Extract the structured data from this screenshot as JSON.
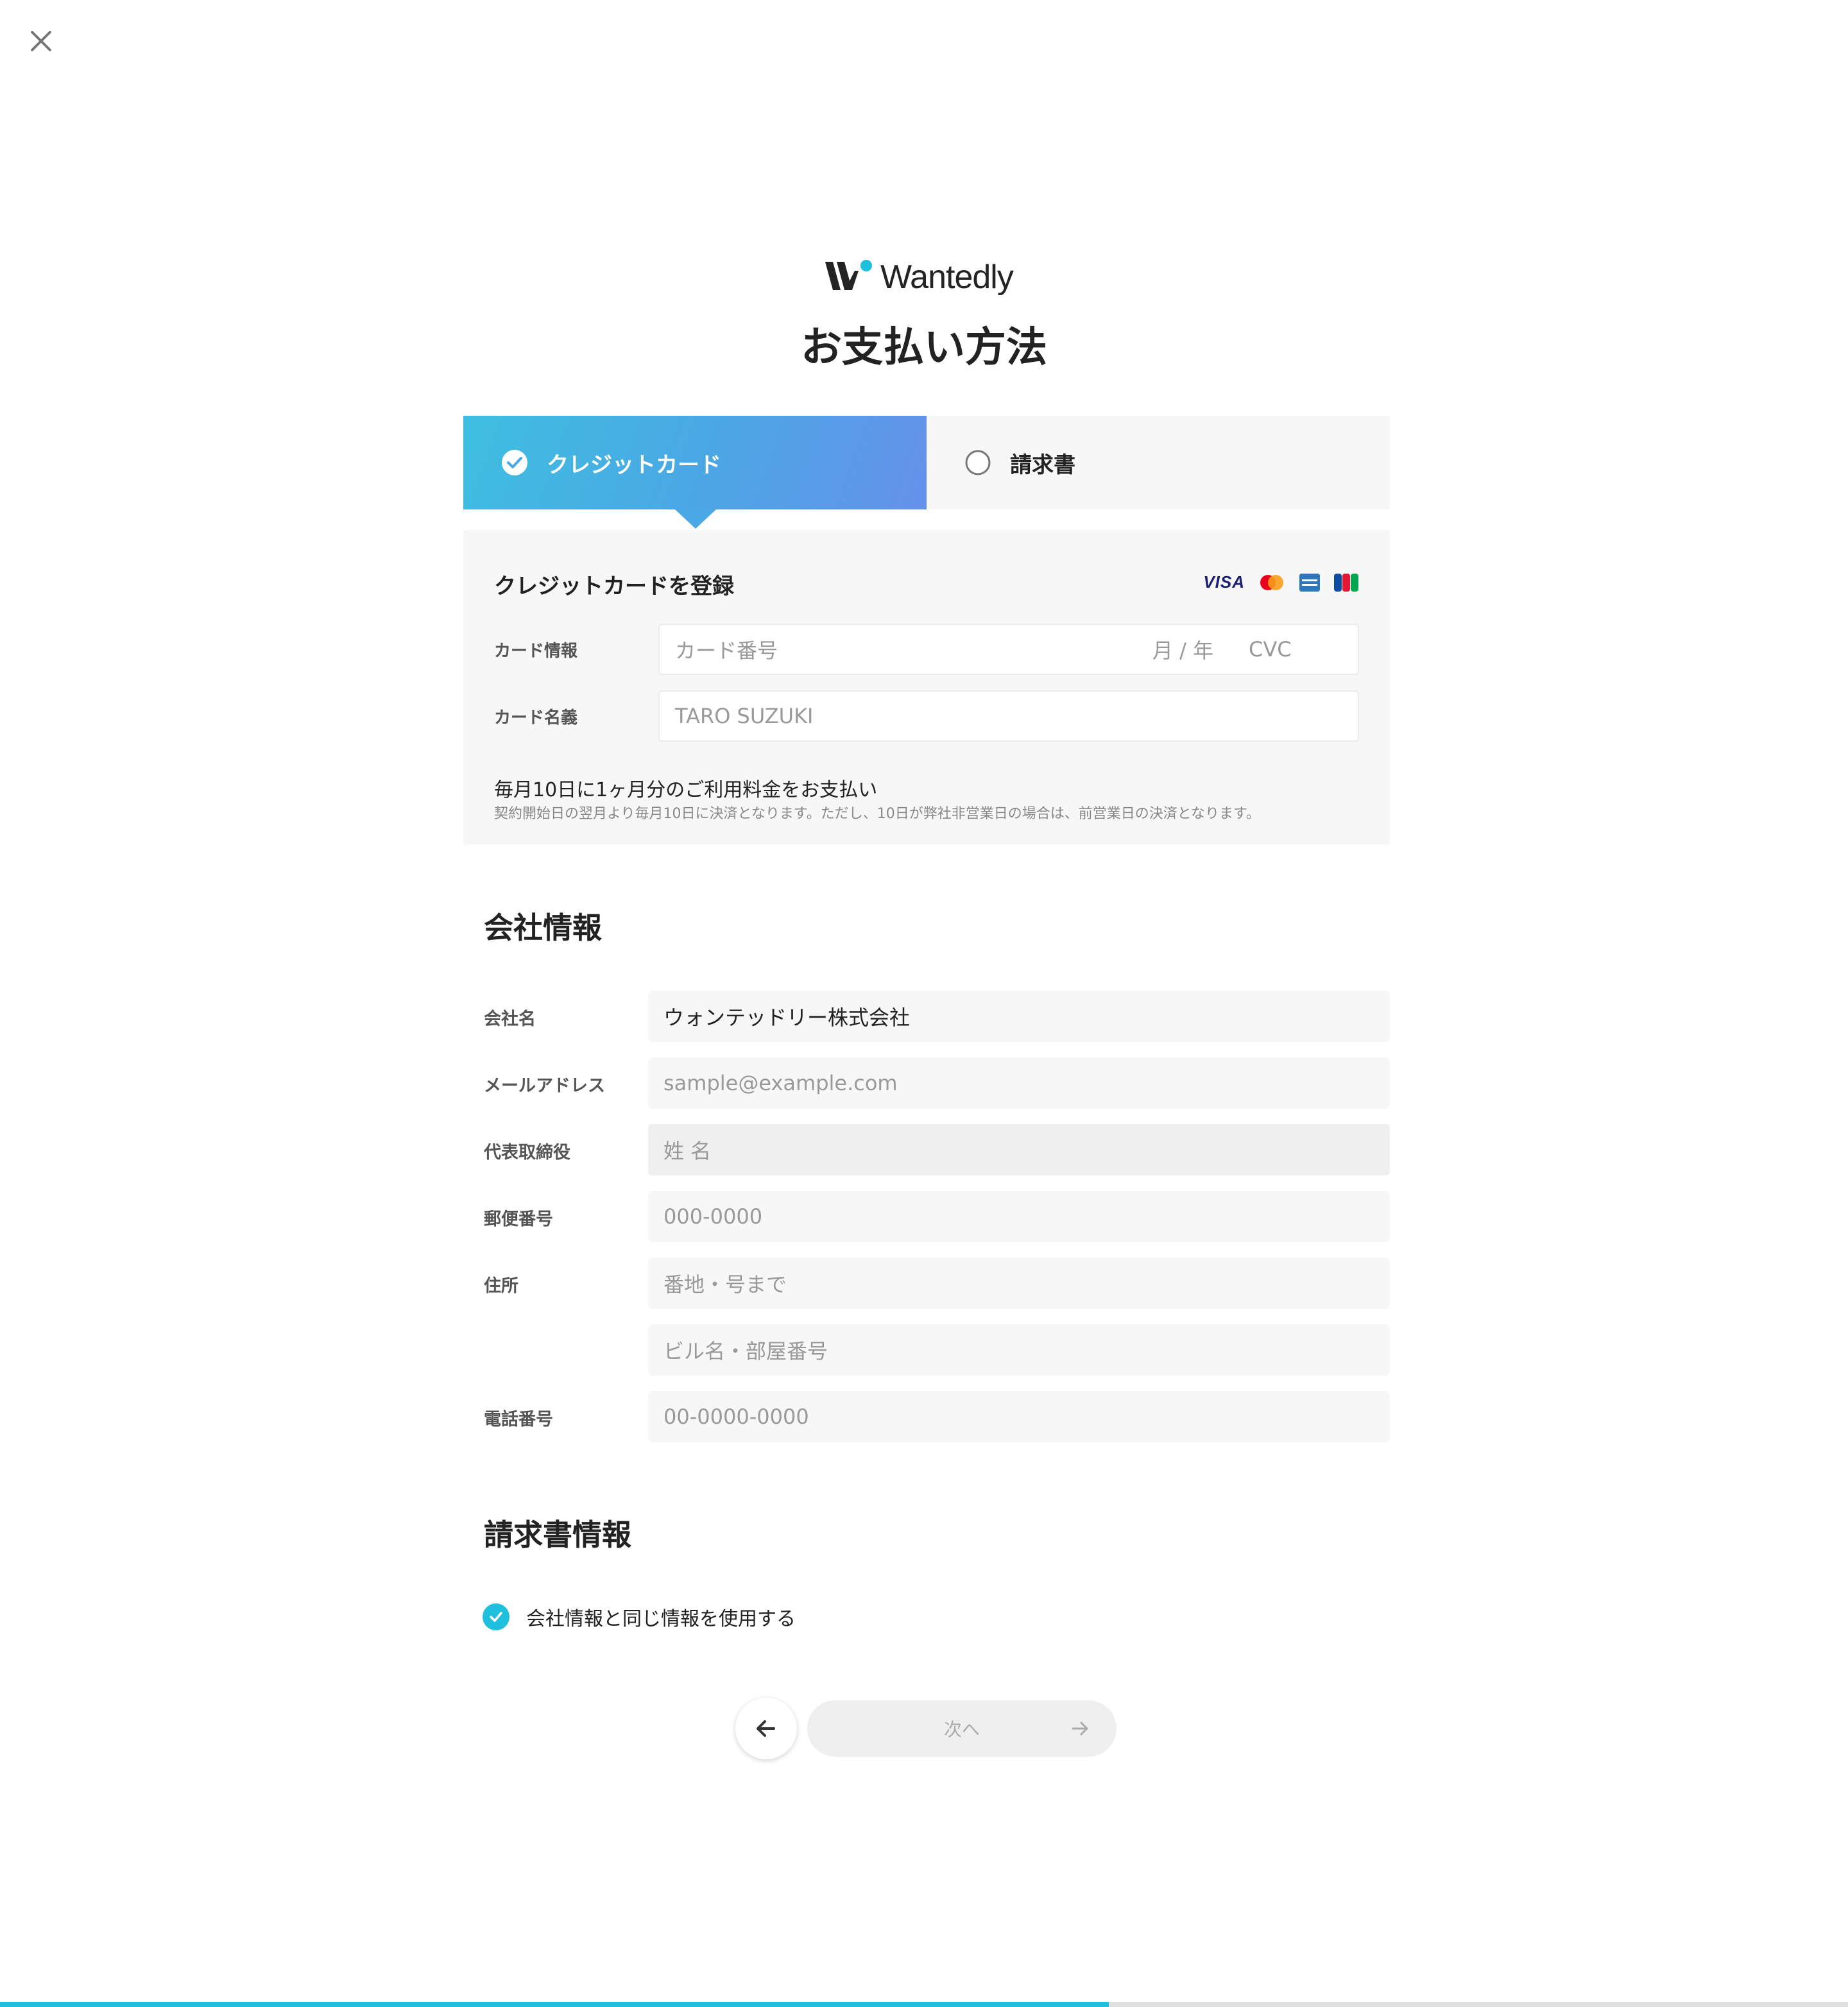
{
  "header": {
    "logo_text": "Wantedly",
    "title": "お支払い方法"
  },
  "tabs": [
    {
      "label": "クレジットカード",
      "selected": true
    },
    {
      "label": "請求書",
      "selected": false
    }
  ],
  "card_panel": {
    "title": "クレジットカードを登録",
    "brands": [
      "VISA",
      "Mastercard",
      "American Express",
      "JCB"
    ],
    "visa_label": "VISA",
    "jcb_label": "JCB",
    "card_info_label": "カード情報",
    "card_number_placeholder": "カード番号",
    "expiry_placeholder": "月 / 年",
    "cvc_placeholder": "CVC",
    "card_name_label": "カード名義",
    "card_name_placeholder": "TARO SUZUKI",
    "note_main": "毎月10日に1ヶ月分のご利用料金をお支払い",
    "note_sub": "契約開始日の翌月より毎月10日に決済となります。ただし、10日が弊社非営業日の場合は、前営業日の決済となります。"
  },
  "company_section": {
    "title": "会社情報",
    "fields": [
      {
        "label": "会社名",
        "value": "ウォンテッドリー株式会社",
        "placeholder": ""
      },
      {
        "label": "メールアドレス",
        "value": "",
        "placeholder": "sample@example.com"
      },
      {
        "label": "代表取締役",
        "value": "",
        "placeholder": "姓 名"
      },
      {
        "label": "郵便番号",
        "value": "",
        "placeholder": "000-0000"
      },
      {
        "label": "住所",
        "value": "",
        "placeholder": "番地・号まで"
      },
      {
        "label": "",
        "value": "",
        "placeholder": "ビル名・部屋番号"
      },
      {
        "label": "電話番号",
        "value": "",
        "placeholder": "00-0000-0000"
      }
    ]
  },
  "invoice_section": {
    "title": "請求書情報",
    "same_info_label": "会社情報と同じ情報を使用する",
    "same_info_checked": true
  },
  "footer": {
    "next_label": "次へ",
    "progress": 0.6
  },
  "colors": {
    "accent": "#1ec0de",
    "tab_gradient_start": "#3ebfe0",
    "tab_gradient_end": "#6591ea"
  },
  "icons": {
    "close": "close-icon",
    "check": "check-circle-icon",
    "radio": "radio-empty-icon",
    "back": "arrow-left-icon",
    "next": "arrow-right-icon"
  }
}
